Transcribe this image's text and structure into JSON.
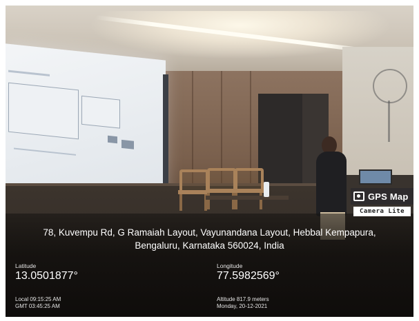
{
  "stamp": {
    "brand": "GPS Map",
    "product": "Camera Lite",
    "address_line1": "78, Kuvempu Rd, G Ramaiah Layout, Vayunandana Layout, Hebbal Kempapura,",
    "address_line2": "Bengaluru, Karnataka 560024, India",
    "latitude_label": "Latitude",
    "latitude_value": "13.0501877°",
    "longitude_label": "Longitude",
    "longitude_value": "77.5982569°",
    "local_time": "Local 09:15:25 AM",
    "gmt_time": "GMT 03:45:25 AM",
    "altitude": "Altitude 817.9 meters",
    "date": "Monday, 20-12-2021"
  },
  "colors": {
    "overlay": "#120f0d",
    "text": "#ffffff",
    "projector_screen": "#eef1f4",
    "wood_wall": "#7a604d"
  },
  "icons": {
    "badge": "gps-map-camera-icon"
  }
}
